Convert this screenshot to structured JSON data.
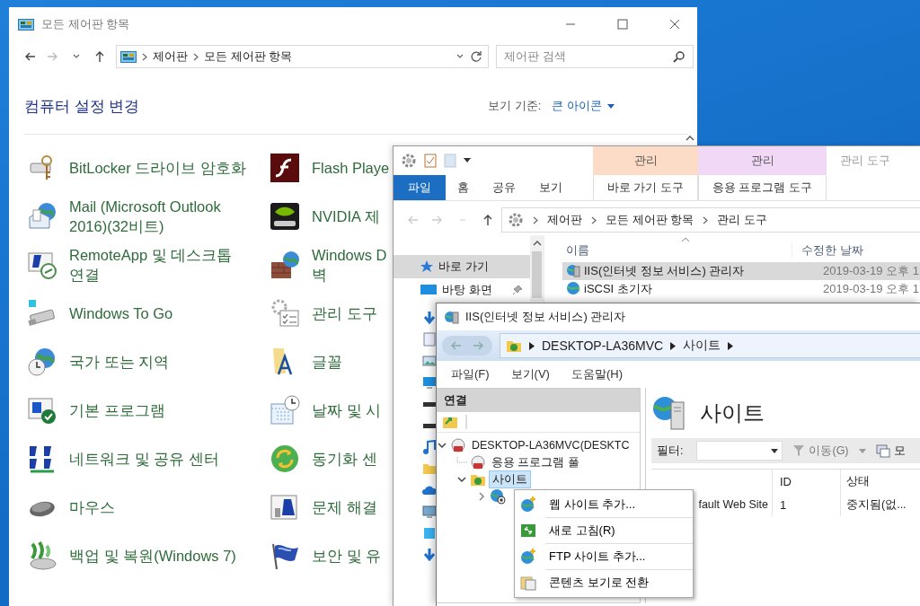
{
  "control_panel": {
    "title": "모든 제어판 항목",
    "address": [
      "제어판",
      "모든 제어판 항목"
    ],
    "search": {
      "placeholder": "제어판 검색"
    },
    "heading": "컴퓨터 설정 변경",
    "view_by": {
      "label": "보기 기준:",
      "value": "큰 아이콘"
    },
    "items": [
      {
        "label": "BitLocker 드라이브 암호화"
      },
      {
        "label": "Flash Playe"
      },
      {
        "label": "Mail (Microsoft Outlook 2016)(32비트)"
      },
      {
        "label": "NVIDIA 제"
      },
      {
        "label": "RemoteApp 및 데스크톱 연결"
      },
      {
        "label": "Windows D 벽"
      },
      {
        "label": "Windows To Go"
      },
      {
        "label": "관리 도구"
      },
      {
        "label": "국가 또는 지역"
      },
      {
        "label": "글꼴"
      },
      {
        "label": "기본 프로그램"
      },
      {
        "label": "날짜 및 시"
      },
      {
        "label": "네트워크 및 공유 센터"
      },
      {
        "label": "동기화 센"
      },
      {
        "label": "마우스"
      },
      {
        "label": "문제 해결"
      },
      {
        "label": "백업 및 복원(Windows 7)"
      },
      {
        "label": "보안 및 유"
      }
    ]
  },
  "explorer": {
    "title": "관리 도구",
    "context_tabs": [
      {
        "group": "관리",
        "label": "바로 가기 도구",
        "color": "#fcdcc6"
      },
      {
        "group": "관리",
        "label": "응용 프로그램 도구",
        "color": "#f1d8f7"
      }
    ],
    "ribbon_tabs": [
      {
        "label": "파일",
        "kind": "file"
      },
      {
        "label": "홈",
        "kind": "tab"
      },
      {
        "label": "공유",
        "kind": "tab"
      },
      {
        "label": "보기",
        "kind": "tab"
      }
    ],
    "address": [
      "제어판",
      "모든 제어판 항목",
      "관리 도구"
    ],
    "nav": [
      {
        "label": "바로 가기",
        "selected": true,
        "pinned": false
      },
      {
        "label": "바탕 화면",
        "selected": false,
        "pinned": true
      }
    ],
    "columns": [
      "이름",
      "수정한 날짜"
    ],
    "rows": [
      {
        "name": "IIS(인터넷 정보 서비스) 관리자",
        "date": "2019-03-19 오후 1",
        "selected": true
      },
      {
        "name": "iSCSI 초기자",
        "date": "2019-03-19 오후 1",
        "selected": false
      }
    ]
  },
  "iis": {
    "title": "IIS(인터넷 정보 서비스) 관리자",
    "address": [
      "DESKTOP-LA36MVC",
      "사이트"
    ],
    "menu": [
      "파일(F)",
      "보기(V)",
      "도움말(H)"
    ],
    "connections": {
      "title": "연결",
      "tree": [
        {
          "label": "DESKTOP-LA36MVC(DESKTC",
          "expanded": true,
          "selected": false,
          "children": [
            {
              "label": "응용 프로그램 풀",
              "selected": false
            },
            {
              "label": "사이트",
              "expanded": true,
              "selected": true,
              "children": [
                {
                  "expanded": false,
                  "selected": false
                }
              ]
            }
          ]
        }
      ]
    },
    "page": {
      "heading": "사이트",
      "filter_label": "필터:",
      "go": "이동(G)",
      "show_all": "모",
      "columns": [
        "ID",
        "상태"
      ],
      "rows": [
        {
          "name": "fault Web Site",
          "id": "1",
          "status": "중지됨(없..."
        }
      ]
    }
  },
  "context_menu": [
    {
      "label": "웹 사이트 추가...",
      "kind": "add-site"
    },
    {
      "label": "새로 고침(R)",
      "kind": "refresh"
    },
    {
      "label": "FTP 사이트 추가...",
      "kind": "add-site"
    },
    {
      "label": "콘텐츠 보기로 전환",
      "kind": "content"
    }
  ]
}
